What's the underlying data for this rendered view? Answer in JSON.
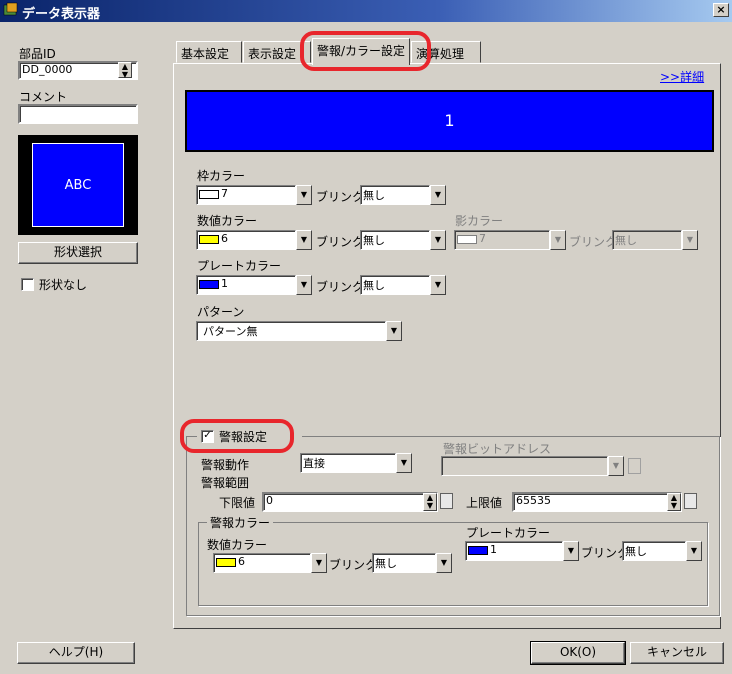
{
  "window": {
    "title": "データ表示器",
    "close_label": "×"
  },
  "left": {
    "part_id_label": "部品ID",
    "part_id_value": "DD_0000",
    "comment_label": "コメント",
    "comment_value": "",
    "preview_text": "ABC",
    "shape_select_label": "形状選択",
    "no_shape_label": "形状なし"
  },
  "tabs": [
    {
      "label": "基本設定"
    },
    {
      "label": "表示設定"
    },
    {
      "label": "警報/カラー設定"
    },
    {
      "label": "演算処理"
    }
  ],
  "panel": {
    "detail_link": ">>詳細",
    "display_value": "1",
    "frame_color": {
      "label": "枠カラー",
      "value": "7",
      "blink_label": "ブリンク",
      "blink_value": "無し"
    },
    "numeric_color": {
      "label": "数値カラー",
      "value": "6",
      "blink_label": "ブリンク",
      "blink_value": "無し"
    },
    "shadow_color": {
      "label": "影カラー",
      "value": "7",
      "blink_label": "ブリンク",
      "blink_value": "無し"
    },
    "plate_color": {
      "label": "プレートカラー",
      "value": "1",
      "blink_label": "ブリンク",
      "blink_value": "無し"
    },
    "pattern": {
      "label": "パターン",
      "value": "パターン無"
    }
  },
  "alarm": {
    "enable_label": "警報設定",
    "action_label": "警報動作",
    "action_value": "直接",
    "bit_address_label": "警報ビットアドレス",
    "bit_address_value": "",
    "range_label": "警報範囲",
    "lower_label": "下限値",
    "lower_value": "0",
    "upper_label": "上限値",
    "upper_value": "65535",
    "color_group_label": "警報カラー",
    "numeric_color": {
      "label": "数値カラー",
      "value": "6",
      "blink_label": "ブリンク",
      "blink_value": "無し"
    },
    "plate_color": {
      "label": "プレートカラー",
      "value": "1",
      "blink_label": "ブリンク",
      "blink_value": "無し"
    }
  },
  "footer": {
    "help_label": "ヘルプ(H)",
    "ok_label": "OK(O)",
    "cancel_label": "キャンセル"
  },
  "colors": {
    "white": "#ffffff",
    "yellow": "#ffff00",
    "blue": "#0000ff",
    "highlight": "#e8262c"
  }
}
